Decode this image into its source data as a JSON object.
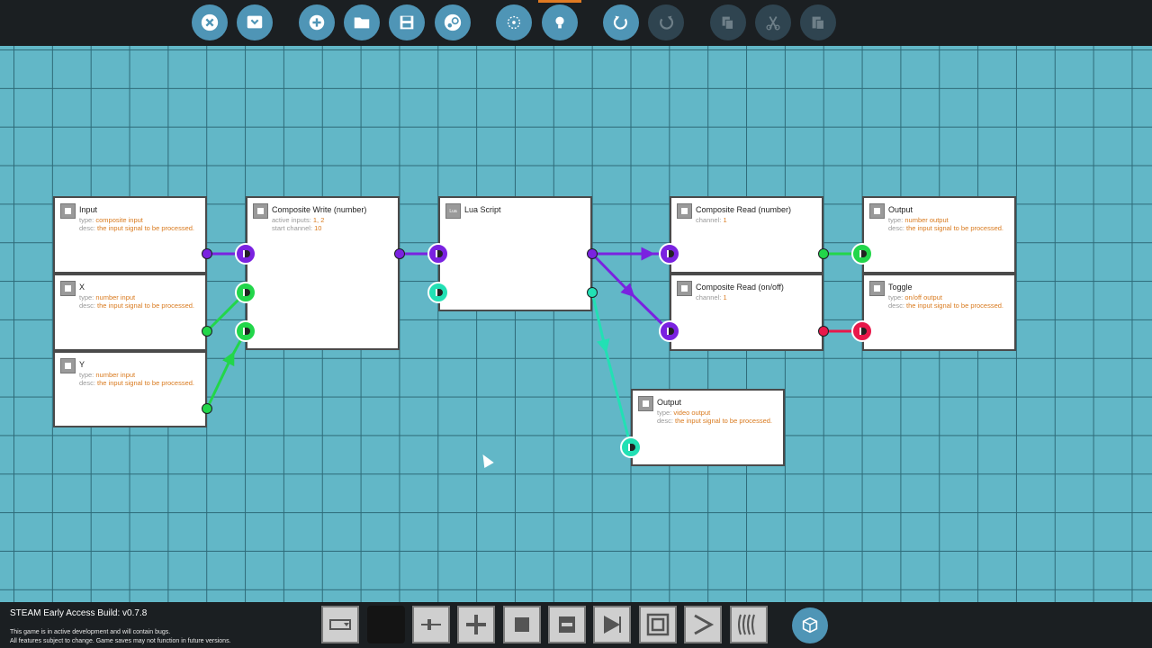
{
  "toolbar": {
    "buttons": [
      {
        "name": "close-button",
        "icon": "close-icon"
      },
      {
        "name": "collapse-button",
        "icon": "chevron-down-icon"
      },
      {
        "name": "new-button",
        "icon": "plus-icon"
      },
      {
        "name": "open-button",
        "icon": "folder-icon"
      },
      {
        "name": "save-button",
        "icon": "save-icon"
      },
      {
        "name": "steam-button",
        "icon": "steam-icon"
      },
      {
        "name": "select-button",
        "icon": "select-icon"
      },
      {
        "name": "hint-button",
        "icon": "lightbulb-icon"
      },
      {
        "name": "undo-button",
        "icon": "undo-icon"
      },
      {
        "name": "redo-button",
        "icon": "redo-icon"
      },
      {
        "name": "copy-button",
        "icon": "copy-icon"
      },
      {
        "name": "cut-button",
        "icon": "cut-icon"
      },
      {
        "name": "paste-button",
        "icon": "paste-icon"
      }
    ],
    "accent_color": "#e07a22"
  },
  "nodes": {
    "input": {
      "title": "Input",
      "type_label": "type:",
      "type_value": "composite input",
      "desc_label": "desc:",
      "desc_value": "the input signal to be processed."
    },
    "x": {
      "title": "X",
      "type_label": "type:",
      "type_value": "number input",
      "desc_label": "desc:",
      "desc_value": "the input signal to be processed."
    },
    "y": {
      "title": "Y",
      "type_label": "type:",
      "type_value": "number input",
      "desc_label": "desc:",
      "desc_value": "the input signal to be processed."
    },
    "composite_write": {
      "title": "Composite Write (number)",
      "p1_label": "active inputs:",
      "p1_value": "1, 2",
      "p2_label": "start channel:",
      "p2_value": "10"
    },
    "lua": {
      "title": "Lua Script",
      "icon_text": "Lua"
    },
    "composite_read_number": {
      "title": "Composite Read (number)",
      "p1_label": "channel:",
      "p1_value": "1"
    },
    "composite_read_onoff": {
      "title": "Composite Read (on/off)",
      "p1_label": "channel:",
      "p1_value": "1"
    },
    "output_number": {
      "title": "Output",
      "type_label": "type:",
      "type_value": "number output",
      "desc_label": "desc:",
      "desc_value": "the input signal to be processed."
    },
    "toggle": {
      "title": "Toggle",
      "type_label": "type:",
      "type_value": "on/off output",
      "desc_label": "desc:",
      "desc_value": "the input signal to be processed."
    },
    "output_video": {
      "title": "Output",
      "type_label": "type:",
      "type_value": "video output",
      "desc_label": "desc:",
      "desc_value": "the input signal to be processed."
    }
  },
  "colors": {
    "composite": "#7a22e0",
    "number": "#22d64a",
    "video": "#22e0b4",
    "onoff": "#e8184a",
    "grid_bg": "#62b7c7"
  },
  "footer": {
    "build_title": "STEAM Early Access Build: v0.7.8",
    "build_note_1": "This game is in active development and will contain bugs.",
    "build_note_2": "All features subject to change. Game saves may not function in future versions."
  },
  "bottom_tools": [
    {
      "name": "tool-dropdown",
      "icon": "dropdown-icon"
    },
    {
      "name": "tool-empty",
      "icon": "blank-icon"
    },
    {
      "name": "tool-slider",
      "icon": "slider-icon"
    },
    {
      "name": "tool-add",
      "icon": "plus-icon"
    },
    {
      "name": "tool-square",
      "icon": "square-icon"
    },
    {
      "name": "tool-subtract",
      "icon": "minus-icon"
    },
    {
      "name": "tool-play",
      "icon": "play-icon"
    },
    {
      "name": "tool-frame",
      "icon": "frame-icon"
    },
    {
      "name": "tool-forward",
      "icon": "forward-icon"
    },
    {
      "name": "tool-waves",
      "icon": "waves-icon"
    },
    {
      "name": "tool-package",
      "icon": "package-icon"
    }
  ]
}
